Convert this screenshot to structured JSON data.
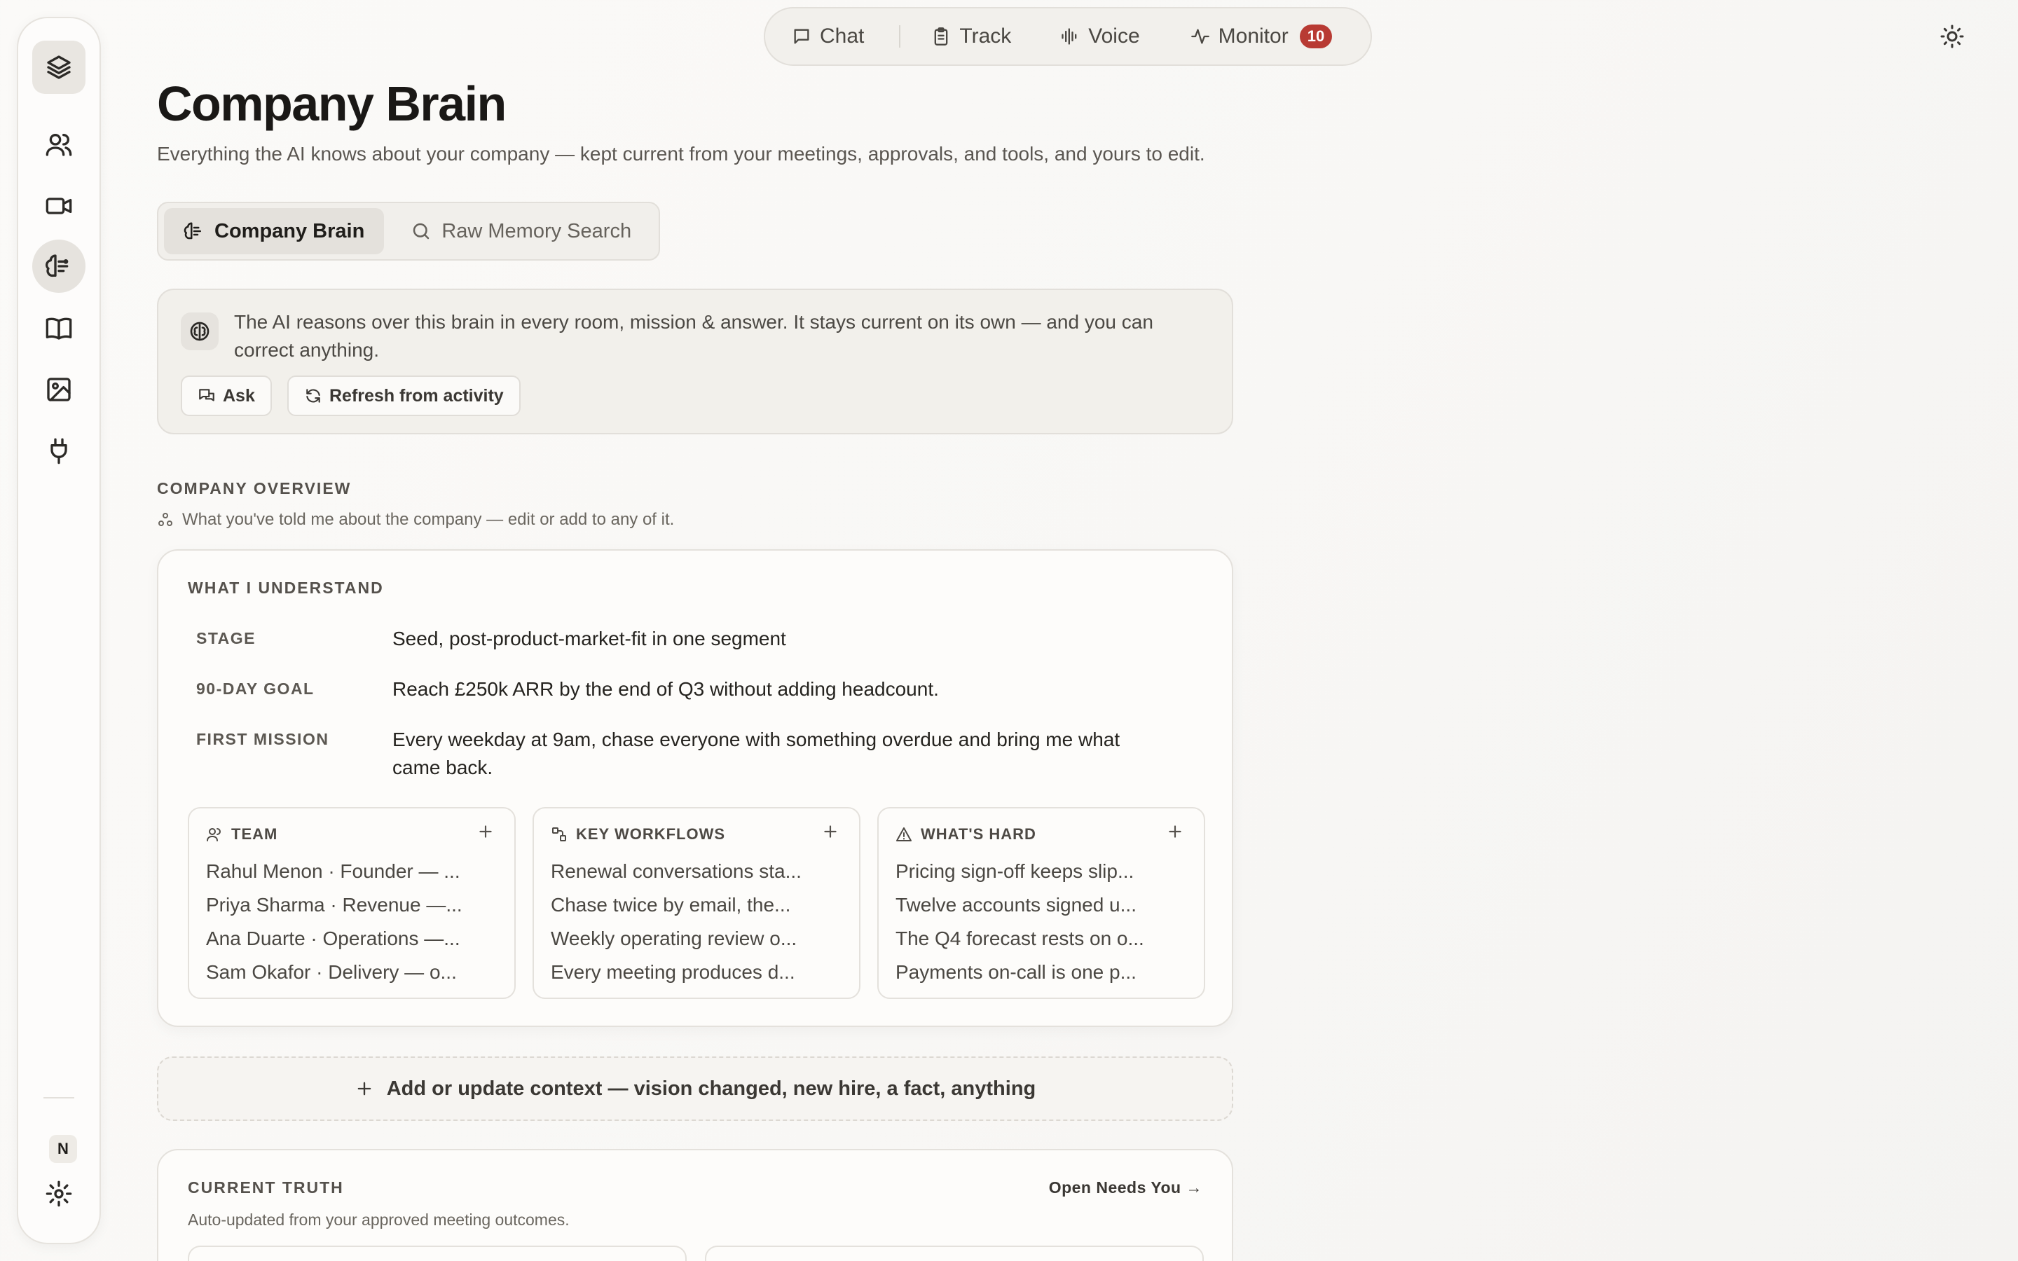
{
  "nav": {
    "items": [
      {
        "label": "Chat",
        "icon": "chat-bubble-icon"
      },
      {
        "label": "Track",
        "icon": "clipboard-icon"
      },
      {
        "label": "Voice",
        "icon": "waveform-icon"
      },
      {
        "label": "Monitor",
        "icon": "activity-pulse-icon",
        "badge": "10"
      }
    ]
  },
  "header": {
    "title": "Company Brain",
    "subtitle": "Everything the AI knows about your company — kept current from your meetings, approvals, and tools, and yours to edit."
  },
  "tabs": [
    {
      "label": "Company Brain",
      "active": true
    },
    {
      "label": "Raw Memory Search",
      "active": false
    }
  ],
  "banner": {
    "text": "The AI reasons over this brain in every room, mission & answer. It stays current on its own — and you can correct anything.",
    "ask_label": "Ask",
    "refresh_label": "Refresh from activity"
  },
  "overview": {
    "label": "COMPANY OVERVIEW",
    "note": "What you've told me about the company — edit or add to any of it.",
    "card_title": "WHAT I UNDERSTAND",
    "fields": [
      {
        "key": "STAGE",
        "value": "Seed, post-product-market-fit in one segment"
      },
      {
        "key": "90-DAY GOAL",
        "value": "Reach £250k ARR by the end of Q3 without adding headcount."
      },
      {
        "key": "FIRST MISSION",
        "value": "Every weekday at 9am, chase everyone with something overdue and bring me what came back."
      }
    ],
    "panels": [
      {
        "title": "TEAM",
        "items": [
          "Rahul Menon · Founder — ...",
          "Priya Sharma · Revenue —...",
          "Ana Duarte · Operations —...",
          "Sam Okafor · Delivery — o..."
        ]
      },
      {
        "title": "KEY WORKFLOWS",
        "items": [
          "Renewal conversations sta...",
          "Chase twice by email, the...",
          "Weekly operating review o...",
          "Every meeting produces d..."
        ]
      },
      {
        "title": "WHAT'S HARD",
        "items": [
          "Pricing sign-off keeps slip...",
          "Twelve accounts signed u...",
          "The Q4 forecast rests on o...",
          "Payments on-call is one p..."
        ]
      }
    ]
  },
  "add_context_label": "Add or update context — vision changed, new hire, a fact, anything",
  "truth": {
    "title": "CURRENT TRUTH",
    "link": "Open Needs You →",
    "note": "Auto-updated from your approved meeting outcomes."
  },
  "sidebar": {
    "user_initial": "N",
    "items": [
      "layers-icon",
      "people-icon",
      "video-camera-icon",
      "brain-icon",
      "book-icon",
      "image-icon",
      "plug-icon"
    ]
  },
  "colors": {
    "accent_badge": "#b83a33",
    "background": "#f8f7f5",
    "card": "#fdfcfa"
  }
}
